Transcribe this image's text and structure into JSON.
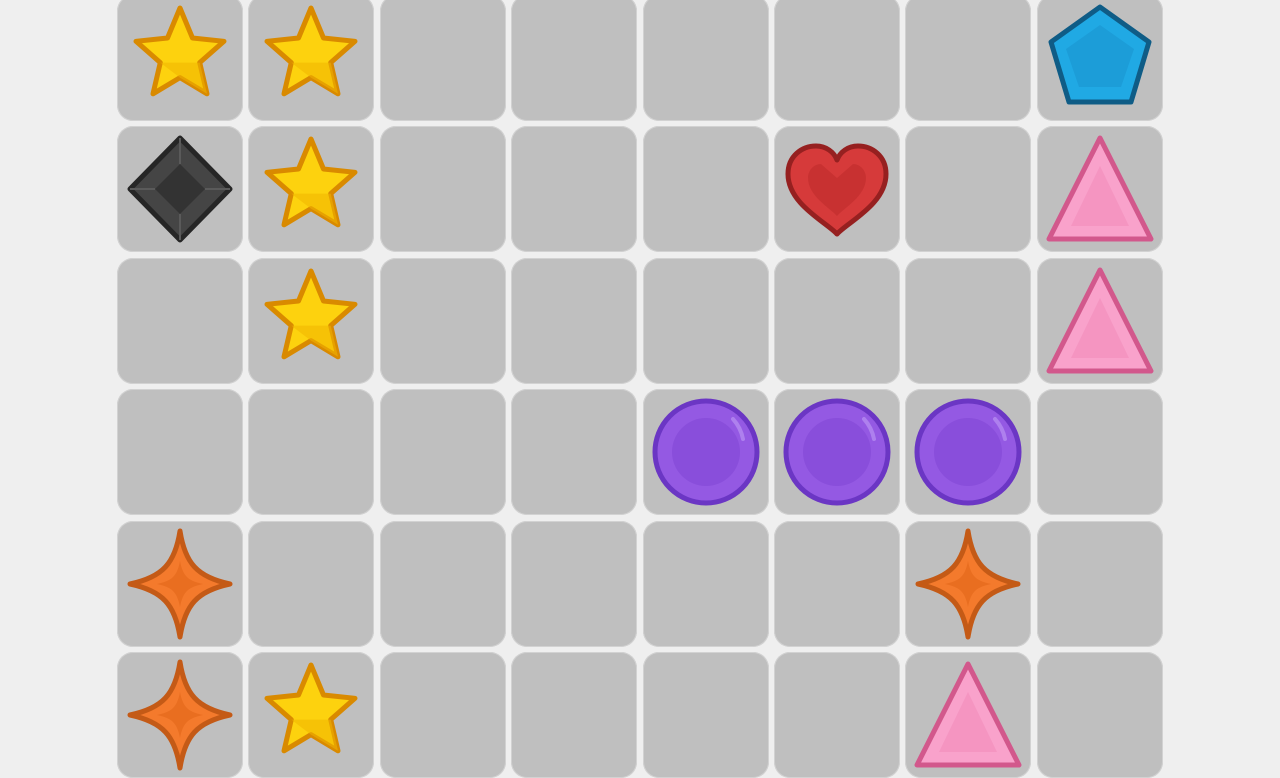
{
  "game": {
    "board": {
      "colors": {
        "background": "#efefef",
        "cell": "#bfbfbf",
        "cell_border": "#d2d2d2"
      },
      "gem_styles": {
        "star": {
          "icon": "star-icon",
          "fill": "#fdd20e",
          "shade": "#f0b400",
          "stroke": "#d98a00"
        },
        "diamond": {
          "icon": "diamond-icon",
          "fill": "#454545",
          "shade": "#2e2e2e",
          "stroke": "#262626"
        },
        "pentagon": {
          "icon": "pentagon-icon",
          "fill": "#20a9e4",
          "shade": "#1888c4",
          "stroke": "#0f5c86"
        },
        "heart": {
          "icon": "heart-icon",
          "fill": "#d63a3a",
          "shade": "#b82828",
          "stroke": "#962020"
        },
        "triangle": {
          "icon": "triangle-icon",
          "fill": "#f9a2cb",
          "shade": "#ef86b6",
          "stroke": "#d2588c"
        },
        "circle": {
          "icon": "circle-icon",
          "fill": "#9459e3",
          "shade": "#7d40d0",
          "stroke": "#6b36c4"
        },
        "sparkle": {
          "icon": "sparkle-icon",
          "fill": "#f47a2c",
          "shade": "#e06518",
          "stroke": "#c45a16"
        }
      },
      "grid": [
        [
          "star",
          "star",
          "",
          "",
          "",
          "",
          "",
          "pentagon"
        ],
        [
          "diamond",
          "star",
          "",
          "",
          "",
          "heart",
          "",
          "triangle"
        ],
        [
          "",
          "star",
          "",
          "",
          "",
          "",
          "",
          "triangle"
        ],
        [
          "",
          "",
          "",
          "",
          "circle",
          "circle",
          "circle",
          ""
        ],
        [
          "sparkle",
          "",
          "",
          "",
          "",
          "",
          "sparkle",
          ""
        ],
        [
          "sparkle",
          "star",
          "",
          "",
          "",
          "",
          "triangle",
          ""
        ]
      ]
    }
  }
}
